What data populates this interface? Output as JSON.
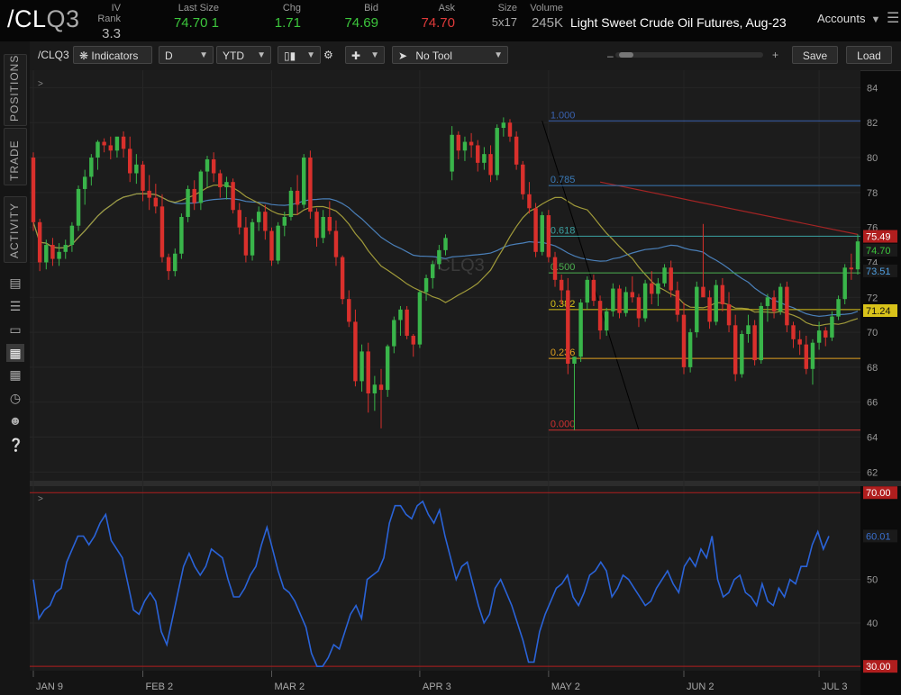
{
  "header": {
    "symbol": "/CL",
    "symbol_suffix": "Q3",
    "quotes": [
      {
        "label": "IV Rank",
        "value": "3.3",
        "color": "#bbbbbb"
      },
      {
        "label": "Last Size",
        "value": "74.70 1",
        "color": "#3cc63c"
      },
      {
        "label": "Chg",
        "value": "1.71",
        "color": "#3cc63c"
      },
      {
        "label": "Bid",
        "value": "74.69",
        "color": "#3cc63c"
      },
      {
        "label": "Ask",
        "value": "74.70",
        "color": "#e03a3a"
      },
      {
        "label": "Size",
        "value": "5x17",
        "color": "#aaaaaa"
      },
      {
        "label": "Volume",
        "value": "245K",
        "color": "#aaaaaa"
      }
    ],
    "description": "Light Sweet Crude Oil Futures, Aug-23",
    "accounts_label": "Accounts"
  },
  "sidebar": {
    "tabs": [
      "POSITIONS",
      "TRADE",
      "ACTIVITY"
    ],
    "icons": [
      "watchlist-icon",
      "list-icon",
      "screen-icon",
      "chart-icon",
      "grid-icon",
      "dashboard-icon",
      "community-icon",
      "help-icon"
    ]
  },
  "toolbar": {
    "symbol": "/CLQ3",
    "indicators_label": "Indicators",
    "interval": "D",
    "range": "YTD",
    "tool_label": "No Tool",
    "zoom_minus": "–",
    "zoom_plus": "+",
    "save_label": "Save",
    "load_label": "Load"
  },
  "chart_data": [
    {
      "type": "candlestick",
      "title": "/CLQ3",
      "ylim": [
        61.5,
        85
      ],
      "y_ticks": [
        62,
        64,
        66,
        68,
        70,
        72,
        74,
        76,
        78,
        80,
        82,
        84
      ],
      "x_tick_labels": [
        "JAN 9",
        "FEB 2",
        "MAR 2",
        "APR 3",
        "MAY 2",
        "JUN 2",
        "JUL 3"
      ],
      "x_tick_index": [
        0,
        17,
        37,
        60,
        80,
        101,
        122
      ],
      "ohlc": [
        [
          80.0,
          80.3,
          75.8,
          76.3
        ],
        [
          76.3,
          76.5,
          73.5,
          74.0
        ],
        [
          74.0,
          75.3,
          73.6,
          75.0
        ],
        [
          75.0,
          75.4,
          73.8,
          74.2
        ],
        [
          74.2,
          75.1,
          73.8,
          74.6
        ],
        [
          74.6,
          75.3,
          74.2,
          75.0
        ],
        [
          75.0,
          76.3,
          74.6,
          76.1
        ],
        [
          76.1,
          78.4,
          75.8,
          78.2
        ],
        [
          78.2,
          79.3,
          77.3,
          78.9
        ],
        [
          78.9,
          80.2,
          78.4,
          80.0
        ],
        [
          80.0,
          81.0,
          79.3,
          80.9
        ],
        [
          80.9,
          81.1,
          80.3,
          80.7
        ],
        [
          80.7,
          81.2,
          79.9,
          80.4
        ],
        [
          80.4,
          81.0,
          80.0,
          81.2
        ],
        [
          81.2,
          81.5,
          80.0,
          80.5
        ],
        [
          80.5,
          81.2,
          78.6,
          79.1
        ],
        [
          79.1,
          80.2,
          78.5,
          79.6
        ],
        [
          79.6,
          79.8,
          77.5,
          78.1
        ],
        [
          78.1,
          79.0,
          77.0,
          77.7
        ],
        [
          77.7,
          78.5,
          76.8,
          77.2
        ],
        [
          77.2,
          77.9,
          74.0,
          74.3
        ],
        [
          74.3,
          74.5,
          73.0,
          73.5
        ],
        [
          73.5,
          74.8,
          73.2,
          74.5
        ],
        [
          74.5,
          76.8,
          74.2,
          76.6
        ],
        [
          76.6,
          78.4,
          76.3,
          78.2
        ],
        [
          78.2,
          78.7,
          77.0,
          77.4
        ],
        [
          77.4,
          79.3,
          77.0,
          79.2
        ],
        [
          79.2,
          80.1,
          78.3,
          79.9
        ],
        [
          79.9,
          80.3,
          78.6,
          79.1
        ],
        [
          79.1,
          79.3,
          77.7,
          78.3
        ],
        [
          78.3,
          78.9,
          77.6,
          78.6
        ],
        [
          78.6,
          78.8,
          76.8,
          77.0
        ],
        [
          77.0,
          77.4,
          75.6,
          76.0
        ],
        [
          76.0,
          76.6,
          74.0,
          74.4
        ],
        [
          74.4,
          76.5,
          74.1,
          76.3
        ],
        [
          76.3,
          77.2,
          75.8,
          76.9
        ],
        [
          76.9,
          77.3,
          75.3,
          75.8
        ],
        [
          75.8,
          76.0,
          73.8,
          74.1
        ],
        [
          74.1,
          76.3,
          73.9,
          76.1
        ],
        [
          76.1,
          76.9,
          75.5,
          76.6
        ],
        [
          76.6,
          78.3,
          76.4,
          78.1
        ],
        [
          78.1,
          79.0,
          76.7,
          77.3
        ],
        [
          77.3,
          80.2,
          77.1,
          80.0
        ],
        [
          80.0,
          80.4,
          76.5,
          76.9
        ],
        [
          76.9,
          77.1,
          74.9,
          75.4
        ],
        [
          75.4,
          77.0,
          75.1,
          76.6
        ],
        [
          76.6,
          77.5,
          75.6,
          75.8
        ],
        [
          75.8,
          76.4,
          73.8,
          74.3
        ],
        [
          74.3,
          74.4,
          71.6,
          71.9
        ],
        [
          71.9,
          72.4,
          70.3,
          70.6
        ],
        [
          70.6,
          71.3,
          66.9,
          67.2
        ],
        [
          67.2,
          69.3,
          66.6,
          68.9
        ],
        [
          68.9,
          69.4,
          65.4,
          66.5
        ],
        [
          66.5,
          67.5,
          65.5,
          67.0
        ],
        [
          67.0,
          67.9,
          64.5,
          66.7
        ],
        [
          66.7,
          69.3,
          66.3,
          69.2
        ],
        [
          69.2,
          70.9,
          68.8,
          70.7
        ],
        [
          70.7,
          71.5,
          69.8,
          71.3
        ],
        [
          71.3,
          71.5,
          69.6,
          69.8
        ],
        [
          69.8,
          69.9,
          68.6,
          69.3
        ],
        [
          69.3,
          72.4,
          69.1,
          72.3
        ],
        [
          72.3,
          73.3,
          71.8,
          73.1
        ],
        [
          73.1,
          74.1,
          72.5,
          73.9
        ],
        [
          73.9,
          75.0,
          73.6,
          74.7
        ],
        [
          74.7,
          75.6,
          74.4,
          75.4
        ]
      ],
      "ohlc_b": [
        [
          79.2,
          81.8,
          78.7,
          81.3
        ],
        [
          81.3,
          81.5,
          79.9,
          80.4
        ],
        [
          80.4,
          81.2,
          79.8,
          80.9
        ],
        [
          80.9,
          81.4,
          80.0,
          80.7
        ],
        [
          80.7,
          81.0,
          79.2,
          79.7
        ],
        [
          79.7,
          80.6,
          79.3,
          80.2
        ],
        [
          80.2,
          80.7,
          78.6,
          79.0
        ],
        [
          79.0,
          81.9,
          78.7,
          81.7
        ],
        [
          81.7,
          82.3,
          81.2,
          82.0
        ],
        [
          82.0,
          82.2,
          80.9,
          81.2
        ],
        [
          81.2,
          81.5,
          79.3,
          79.6
        ],
        [
          79.6,
          79.8,
          77.6,
          77.9
        ],
        [
          77.9,
          78.6,
          76.8,
          77.1
        ],
        [
          77.1,
          77.4,
          74.3,
          74.6
        ],
        [
          74.6,
          76.9,
          74.4,
          76.7
        ],
        [
          76.7,
          77.0,
          74.0,
          74.3
        ],
        [
          74.3,
          74.6,
          72.6,
          73.0
        ],
        [
          73.0,
          73.3,
          71.6,
          72.4
        ],
        [
          72.4,
          73.1,
          67.6,
          68.2
        ],
        [
          68.2,
          68.6,
          64.4,
          68.6
        ],
        [
          68.6,
          71.9,
          68.3,
          71.7
        ],
        [
          71.7,
          73.2,
          71.3,
          73.0
        ],
        [
          73.0,
          73.3,
          71.5,
          71.8
        ],
        [
          71.8,
          72.1,
          69.6,
          70.1
        ],
        [
          70.1,
          71.4,
          69.8,
          71.2
        ],
        [
          71.2,
          72.8,
          70.9,
          72.5
        ],
        [
          72.5,
          72.7,
          70.8,
          71.1
        ],
        [
          71.1,
          72.6,
          70.9,
          72.3
        ],
        [
          72.3,
          73.2,
          71.7,
          72.0
        ],
        [
          72.0,
          72.2,
          70.3,
          70.8
        ],
        [
          70.8,
          73.0,
          70.6,
          72.8
        ],
        [
          72.8,
          73.5,
          71.6,
          72.2
        ],
        [
          72.2,
          73.1,
          71.5,
          72.8
        ],
        [
          72.8,
          73.9,
          72.6,
          73.7
        ],
        [
          73.7,
          74.1,
          72.0,
          72.4
        ],
        [
          72.4,
          72.9,
          70.6,
          71.0
        ],
        [
          71.0,
          71.7,
          67.6,
          68.0
        ],
        [
          68.0,
          70.2,
          67.7,
          70.0
        ],
        [
          70.0,
          72.9,
          69.7,
          72.6
        ],
        [
          72.6,
          76.2,
          72.3,
          72.0
        ],
        [
          72.0,
          72.4,
          70.2,
          70.6
        ],
        [
          70.6,
          73.0,
          70.4,
          72.7
        ],
        [
          72.7,
          73.1,
          71.2,
          71.6
        ],
        [
          71.6,
          72.3,
          70.0,
          70.4
        ],
        [
          70.4,
          71.0,
          67.2,
          67.6
        ],
        [
          67.6,
          70.1,
          67.4,
          69.9
        ],
        [
          69.9,
          71.0,
          69.4,
          70.4
        ],
        [
          70.4,
          70.7,
          68.1,
          68.4
        ],
        [
          68.4,
          71.7,
          68.2,
          71.5
        ],
        [
          71.5,
          72.2,
          70.6,
          72.0
        ],
        [
          72.0,
          72.4,
          70.8,
          71.2
        ],
        [
          71.2,
          72.8,
          71.0,
          72.6
        ],
        [
          72.6,
          72.9,
          70.0,
          70.4
        ],
        [
          70.4,
          70.6,
          69.1,
          69.6
        ],
        [
          69.6,
          70.1,
          68.7,
          69.3
        ],
        [
          69.3,
          69.8,
          67.6,
          67.9
        ],
        [
          67.9,
          69.6,
          67.0,
          69.4
        ],
        [
          69.4,
          70.6,
          69.0,
          70.1
        ],
        [
          70.1,
          70.3,
          69.2,
          69.7
        ],
        [
          69.7,
          71.2,
          69.5,
          70.9
        ],
        [
          70.9,
          72.1,
          70.7,
          71.9
        ],
        [
          71.9,
          73.9,
          71.6,
          73.7
        ],
        [
          73.7,
          74.5,
          73.0,
          73.6
        ],
        [
          73.6,
          75.6,
          73.3,
          75.2
        ]
      ],
      "fibonacci": [
        {
          "level": "1.000",
          "price": 82.1,
          "color": "#3a62b0"
        },
        {
          "level": "0.785",
          "price": 78.4,
          "color": "#3a7ab8"
        },
        {
          "level": "0.618",
          "price": 75.5,
          "color": "#3aa0a0"
        },
        {
          "level": "0.500",
          "price": 73.4,
          "color": "#4caf50"
        },
        {
          "level": "0.382",
          "price": 71.3,
          "color": "#d8c21a"
        },
        {
          "level": "0.236",
          "price": 68.5,
          "color": "#e0a020"
        },
        {
          "level": "0.000",
          "price": 64.4,
          "color": "#d03030"
        }
      ],
      "price_labels": [
        {
          "text": "75.49",
          "price": 75.49,
          "bg": "#b01e1e",
          "fg": "#ffffff"
        },
        {
          "text": "74.70",
          "price": 74.7,
          "bg": "#1a1a1a",
          "fg": "#3cc63c"
        },
        {
          "text": "73.51",
          "price": 73.51,
          "bg": "#1a1a1a",
          "fg": "#4f9fe0"
        },
        {
          "text": "71.24",
          "price": 71.24,
          "bg": "#d8c21a",
          "fg": "#111111"
        }
      ],
      "watermark": "/CLQ3",
      "colors": {
        "up": "#39b54a",
        "down": "#d9302c",
        "ma_blue": "#4a7fb8",
        "ma_olive": "#a09a3a",
        "ma_red": "#a42424"
      }
    },
    {
      "type": "line",
      "ylim": [
        29,
        71.5
      ],
      "y_ticks": [
        40,
        50
      ],
      "bands": [
        {
          "value": 70,
          "text": "70.00",
          "color": "#b01e1e"
        },
        {
          "value": 30,
          "text": "30.00",
          "color": "#b01e1e"
        }
      ],
      "current_label": {
        "text": "60.01",
        "value": 60.01,
        "color": "#3a70d0"
      },
      "series": [
        {
          "values": [
            50,
            41,
            43,
            44,
            47,
            48,
            54,
            57,
            60,
            60,
            58,
            60,
            63,
            65,
            59,
            57,
            55,
            49,
            43,
            42,
            45,
            47,
            45,
            38,
            35,
            41,
            47,
            53,
            56,
            53,
            51,
            53,
            57,
            56,
            55,
            50,
            46,
            46,
            48,
            51,
            53,
            58,
            62,
            57,
            52,
            48,
            47,
            45,
            42,
            39,
            33,
            30,
            30,
            32,
            35,
            34,
            38,
            42,
            44,
            41,
            50,
            51,
            52,
            55,
            63,
            67,
            67,
            65,
            64,
            67,
            68,
            65,
            63,
            66,
            60,
            55,
            50,
            53,
            54,
            49,
            44,
            40,
            42,
            48,
            50,
            47,
            44,
            40,
            36,
            31,
            31,
            38,
            42,
            45,
            48,
            49,
            51,
            46,
            44,
            47,
            51,
            52,
            54,
            52,
            46,
            48,
            51,
            50,
            48,
            46,
            44,
            45,
            48,
            50,
            52,
            49,
            47,
            53,
            55,
            53,
            57,
            55,
            60,
            50,
            46,
            47,
            50,
            51,
            47,
            46,
            44,
            49,
            45,
            44,
            48,
            46,
            50,
            49,
            53,
            53,
            58,
            61,
            57,
            60
          ]
        }
      ]
    }
  ]
}
